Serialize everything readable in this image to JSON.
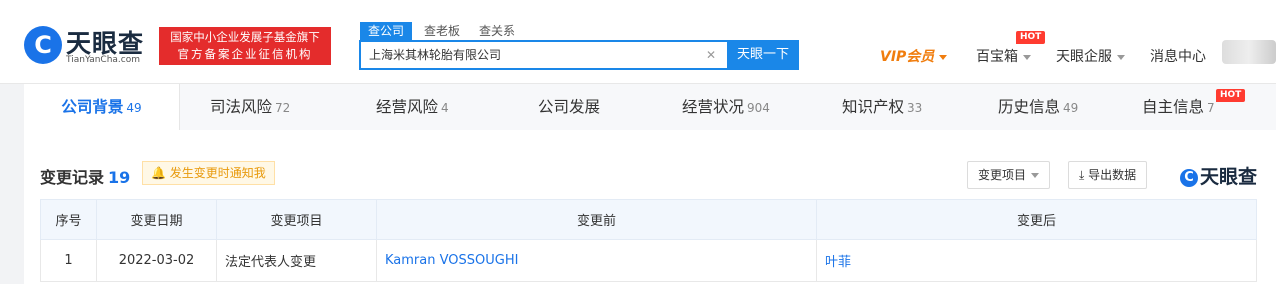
{
  "header": {
    "logo_name": "天眼查",
    "logo_url": "TianYanCha.com",
    "badge_line1": "国家中小企业发展子基金旗下",
    "badge_line2": "官方备案企业征信机构",
    "search_tabs": [
      "查公司",
      "查老板",
      "查关系"
    ],
    "search_value": "上海米其林轮胎有限公司",
    "search_button": "天眼一下",
    "nav": {
      "vip": "VIP会员",
      "treasure": "百宝箱",
      "enterprise": "天眼企服",
      "messages": "消息中心"
    },
    "hot_label": "HOT"
  },
  "tabs": [
    {
      "label": "公司背景",
      "count": "49"
    },
    {
      "label": "司法风险",
      "count": "72"
    },
    {
      "label": "经营风险",
      "count": "4"
    },
    {
      "label": "公司发展",
      "count": ""
    },
    {
      "label": "经营状况",
      "count": "904"
    },
    {
      "label": "知识产权",
      "count": "33"
    },
    {
      "label": "历史信息",
      "count": "49"
    },
    {
      "label": "自主信息",
      "count": "7"
    }
  ],
  "section": {
    "title": "变更记录",
    "count": "19",
    "notify": "发生变更时通知我",
    "filter_button": "变更项目",
    "export_button": "导出数据",
    "watermark": "天眼查"
  },
  "table": {
    "headers": [
      "序号",
      "变更日期",
      "变更项目",
      "变更前",
      "变更后"
    ],
    "rows": [
      {
        "index": "1",
        "date": "2022-03-02",
        "item": "法定代表人变更",
        "before": "Kamran VOSSOUGHI",
        "after": "叶菲"
      }
    ]
  },
  "colors": {
    "accent": "#1a73e8",
    "vip": "#f07d0e",
    "badge": "#e42c2c"
  },
  "icons": [
    "search-clear-icon",
    "bell-icon",
    "download-icon",
    "caret-down-icon"
  ]
}
